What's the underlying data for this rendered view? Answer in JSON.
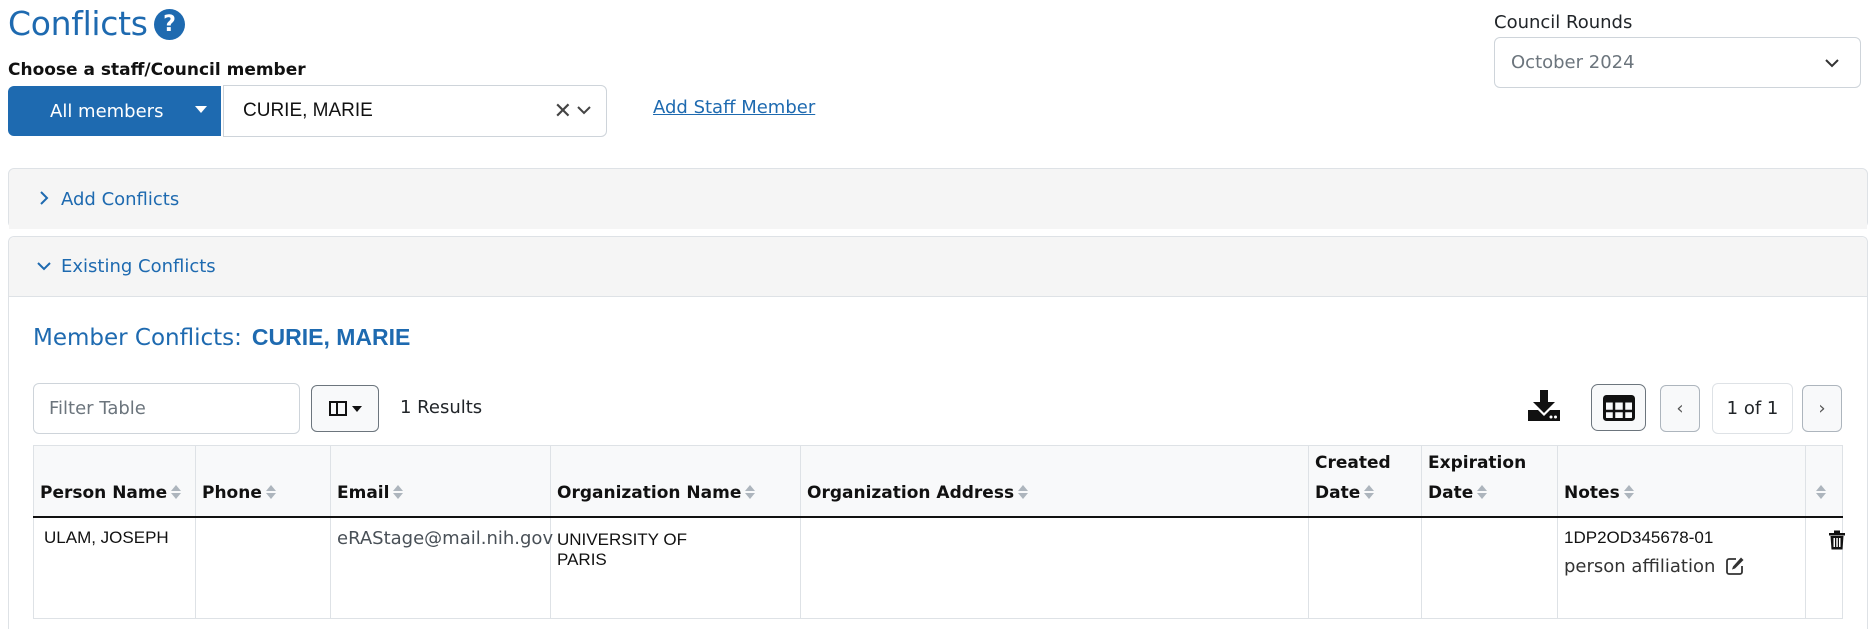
{
  "header": {
    "title": "Conflicts",
    "help_icon": "question-circle-icon",
    "choose_label": "Choose a staff/Council member",
    "members_filter_button": "All members",
    "selected_member": "CURIE, MARIE",
    "add_staff_link": "Add Staff Member",
    "council_rounds_label": "Council Rounds",
    "council_rounds_value": "October 2024"
  },
  "accordion": {
    "add_conflicts": {
      "label": "Add Conflicts",
      "expanded": false
    },
    "existing_conflicts": {
      "label": "Existing Conflicts",
      "expanded": true
    }
  },
  "existing": {
    "heading_prefix": "Member Conflicts:",
    "heading_name": "CURIE, MARIE",
    "filter_placeholder": "Filter Table",
    "results_text": "1 Results",
    "pagination": {
      "prev": "‹",
      "page_text": "1 of 1",
      "next": "›"
    },
    "icons": {
      "download": "download-icon",
      "grid": "table-grid-icon",
      "columns": "columns-icon"
    }
  },
  "table": {
    "columns": [
      {
        "line1": "",
        "line2": "Person Name"
      },
      {
        "line1": "",
        "line2": "Phone"
      },
      {
        "line1": "",
        "line2": "Email"
      },
      {
        "line1": "",
        "line2": "Organization Name"
      },
      {
        "line1": "",
        "line2": "Organization Address"
      },
      {
        "line1": "Created",
        "line2": "Date"
      },
      {
        "line1": "Expiration",
        "line2": "Date"
      },
      {
        "line1": "",
        "line2": "Notes"
      },
      {
        "line1": "",
        "line2": ""
      }
    ],
    "rows": [
      {
        "person_name": "ULAM, JOSEPH",
        "phone": "",
        "email": "eRAStage@mail.nih.gov",
        "organization_name_line1": "UNIVERSITY OF",
        "organization_name_line2": "PARIS",
        "organization_address": "",
        "created_date": "",
        "expiration_date": "",
        "notes_id": "1DP2OD345678-01",
        "notes_text": "person affiliation"
      }
    ]
  },
  "colors": {
    "primary": "#1e6ab0",
    "panel_bg": "#f5f5f5",
    "border": "#dee2e6"
  }
}
